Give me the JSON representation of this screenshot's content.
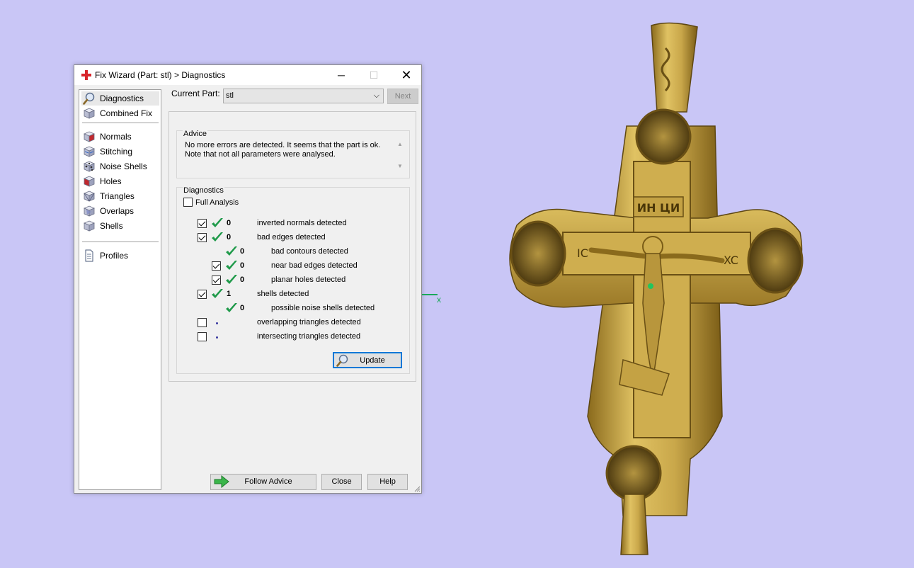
{
  "window": {
    "title": "Fix Wizard (Part: stl) > Diagnostics",
    "minimize": "─",
    "maximize": "☐",
    "close": "✕"
  },
  "sidebar": {
    "items": [
      {
        "label": "Diagnostics",
        "icon": "magnifier-icon"
      },
      {
        "label": "Combined Fix",
        "icon": "cube-icon"
      },
      {
        "label": "Normals",
        "icon": "normals-cube-icon"
      },
      {
        "label": "Stitching",
        "icon": "stitching-cube-icon"
      },
      {
        "label": "Noise Shells",
        "icon": "noise-shells-icon"
      },
      {
        "label": "Holes",
        "icon": "holes-cube-icon"
      },
      {
        "label": "Triangles",
        "icon": "triangles-cube-icon"
      },
      {
        "label": "Overlaps",
        "icon": "overlaps-cube-icon"
      },
      {
        "label": "Shells",
        "icon": "shells-cube-icon"
      },
      {
        "label": "Profiles",
        "icon": "document-icon"
      }
    ]
  },
  "header": {
    "current_part_label": "Current Part:",
    "current_part_value": "stl",
    "next_label": "Next"
  },
  "advice": {
    "title": "Advice",
    "text_line1": "No more errors are detected. It seems that the part is ok.",
    "text_line2": "Note that not all parameters were analysed."
  },
  "diagnostics": {
    "title": "Diagnostics",
    "full_analysis_label": "Full Analysis",
    "full_analysis_checked": false,
    "rows": [
      {
        "label": "inverted normals detected",
        "count": "0",
        "checked": true,
        "status": "ok"
      },
      {
        "label": "bad edges detected",
        "count": "0",
        "checked": true,
        "status": "ok"
      },
      {
        "label": "bad contours detected",
        "count": "0",
        "checked": null,
        "status": "ok"
      },
      {
        "label": "near bad edges detected",
        "count": "0",
        "checked": true,
        "status": "ok"
      },
      {
        "label": "planar holes detected",
        "count": "0",
        "checked": true,
        "status": "ok"
      },
      {
        "label": "shells detected",
        "count": "1",
        "checked": true,
        "status": "ok"
      },
      {
        "label": "possible noise shells detected",
        "count": "0",
        "checked": null,
        "status": "ok"
      },
      {
        "label": "overlapping triangles detected",
        "count": "",
        "checked": false,
        "status": "not-analysed"
      },
      {
        "label": "intersecting triangles detected",
        "count": "",
        "checked": false,
        "status": "not-analysed"
      }
    ],
    "update_label": "Update"
  },
  "footer": {
    "follow_advice_label": "Follow Advice",
    "close_label": "Close",
    "help_label": "Help"
  },
  "viewport": {
    "axis_label": "x",
    "model": "gold-orthodox-cross-3d-model",
    "model_text": "ИН ЦИ",
    "model_text_left": "IC",
    "model_text_right": "XC"
  },
  "colors": {
    "background": "#c9c6f6",
    "gold": "#c9a74a",
    "check_green": "#1f9a4a",
    "axis_green": "#1aa85a",
    "focus_blue": "#0078d7"
  }
}
